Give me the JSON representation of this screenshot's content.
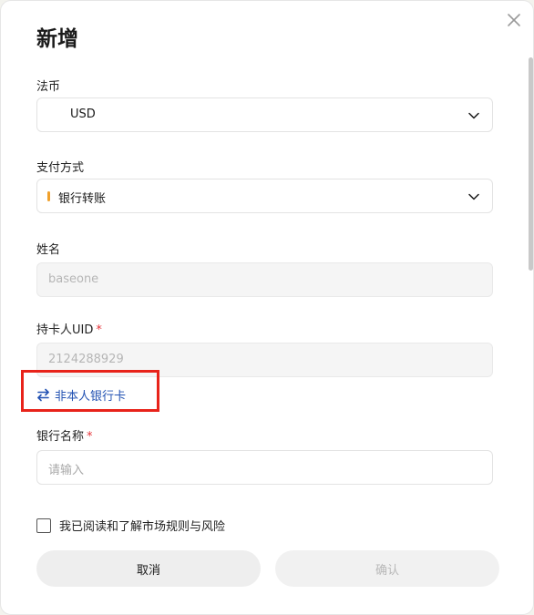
{
  "dialog": {
    "title": "新增",
    "close_icon": "close-icon"
  },
  "fiat": {
    "label": "法币",
    "value": "USD"
  },
  "payment": {
    "label": "支付方式",
    "value": "银行转账",
    "marker_color": "#f0a02b"
  },
  "name": {
    "label": "姓名",
    "value": "baseone"
  },
  "uid": {
    "label": "持卡人UID",
    "required_mark": "*",
    "value": "2124288929"
  },
  "switch_link": {
    "label": "非本人银行卡",
    "icon": "swap-arrows-icon",
    "color": "#2453b3"
  },
  "bank": {
    "label": "银行名称",
    "required_mark": "*",
    "placeholder": "请输入"
  },
  "agreement": {
    "label": "我已阅读和了解市场规则与风险",
    "checked": false
  },
  "buttons": {
    "cancel": "取消",
    "confirm": "确认"
  },
  "colors": {
    "required": "#e5353b",
    "highlight": "#e8231a"
  }
}
